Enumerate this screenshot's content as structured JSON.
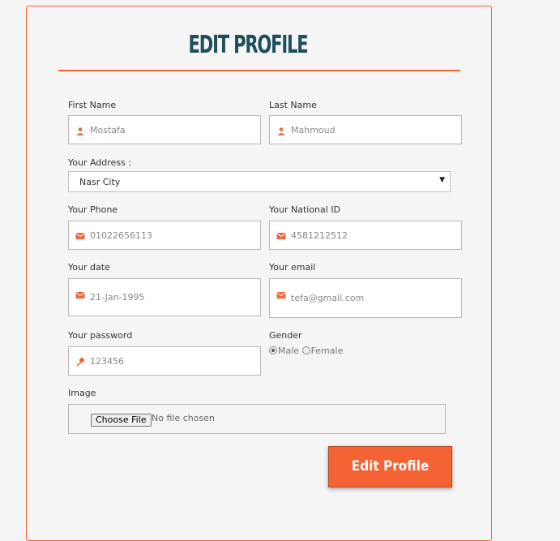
{
  "form": {
    "title": "EDIT PROFILE",
    "submit_label": "Edit Profile"
  },
  "fields": {
    "first_name": {
      "label": "First Name",
      "value": "Mostafa",
      "icon": "user-icon"
    },
    "last_name": {
      "label": "Last Name",
      "value": "Mahmoud",
      "icon": "user-icon"
    },
    "address": {
      "label": "Your Address :",
      "value": "Nasr City"
    },
    "phone": {
      "label": "Your Phone",
      "value": "01022656113",
      "icon": "envelope-icon"
    },
    "national_id": {
      "label": "Your National ID",
      "value": "4581212512",
      "icon": "envelope-icon"
    },
    "date": {
      "label": "Your date",
      "value": "21-Jan-1995",
      "icon": "envelope-icon"
    },
    "email": {
      "label": "Your email",
      "value": "tefa@gmail.com",
      "icon": "envelope-icon"
    },
    "password": {
      "label": "Your password",
      "value": "123456",
      "icon": "key-icon"
    },
    "gender": {
      "label": "Gender",
      "options": [
        "Male",
        "Female"
      ],
      "selected": "Male"
    },
    "image": {
      "label": "Image",
      "button_label": "Choose File",
      "status": "No file chosen"
    }
  },
  "colors": {
    "accent": "#f0663a",
    "title": "#1f4f5c",
    "button": "#f46333"
  }
}
